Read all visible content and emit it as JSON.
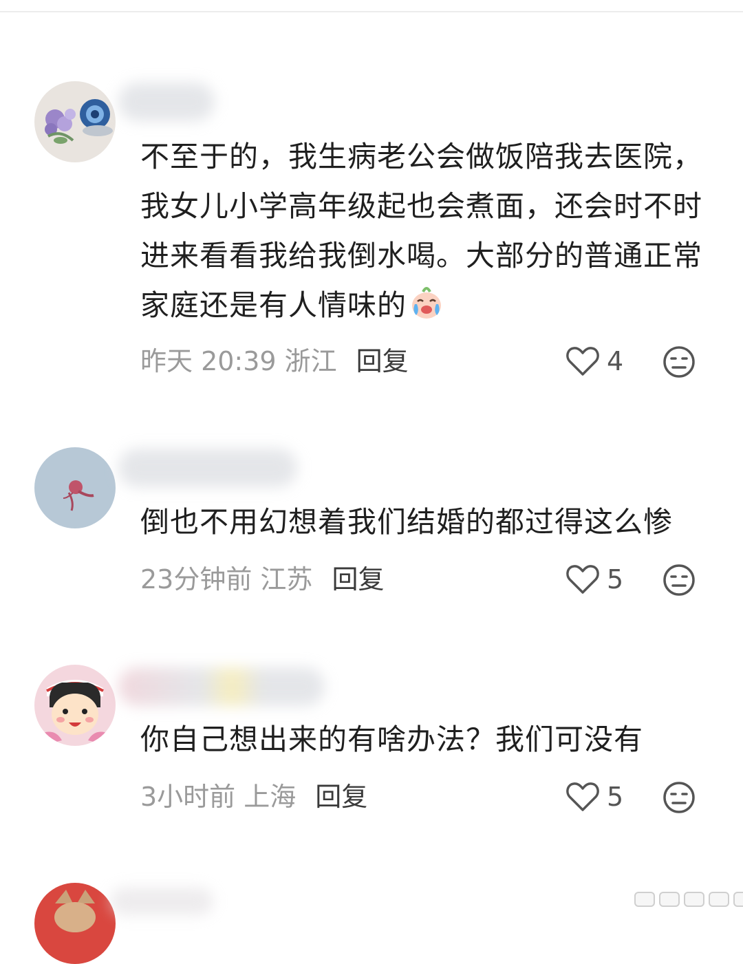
{
  "comments": [
    {
      "text": "不至于的，我生病老公会做饭陪我去医院，我女儿小学高年级起也会煮面，还会时不时进来看看我给我倒水喝。大部分的普通正常家庭还是有人情味的",
      "time_location": "昨天 20:39 浙江",
      "reply_label": "回复",
      "likes": "4",
      "emoji_icon": "crying-face-emoji-icon"
    },
    {
      "text": "倒也不用幻想着我们结婚的都过得这么惨",
      "time_location": "23分钟前 江苏",
      "reply_label": "回复",
      "likes": "5"
    },
    {
      "text": "你自己想出来的有啥办法？我们可没有",
      "time_location": "3小时前 上海",
      "reply_label": "回复",
      "likes": "5"
    }
  ],
  "icons": {
    "like": "heart-outline-icon",
    "dislike": "neutral-face-icon"
  },
  "colors": {
    "meta_text": "#9a9a9a",
    "reply_text": "#3a3a3a",
    "body_text": "#1f1f1f"
  }
}
